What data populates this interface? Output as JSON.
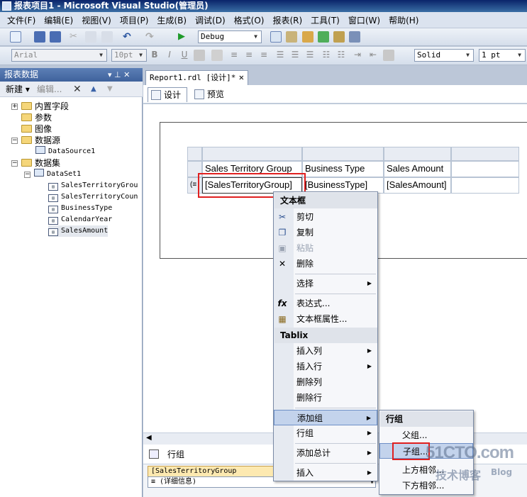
{
  "window": {
    "title": "报表项目1 - Microsoft Visual Studio(管理员)"
  },
  "menu": [
    "文件(F)",
    "编辑(E)",
    "视图(V)",
    "项目(P)",
    "生成(B)",
    "调试(D)",
    "格式(O)",
    "报表(R)",
    "工具(T)",
    "窗口(W)",
    "帮助(H)"
  ],
  "toolbar1": {
    "config": "Debug"
  },
  "toolbar2": {
    "font": "Arial",
    "size": "10pt",
    "border_style": "Solid",
    "border_width": "1 pt"
  },
  "report_data": {
    "title": "报表数据",
    "pin": "▾ ⊥ ✕",
    "new_label": "新建 ▾",
    "edit_label": "编辑...",
    "tree": [
      "内置字段",
      "参数",
      "图像",
      "数据源",
      "DataSource1",
      "数据集",
      "DataSet1",
      "SalesTerritoryGrou",
      "SalesTerritoryCoun",
      "BusinessType",
      "CalendarYear",
      "SalesAmount"
    ]
  },
  "document": {
    "tab": "Report1.rdl [设计]*",
    "design_tab": "设计",
    "preview_tab": "预览"
  },
  "tablix": {
    "headers": [
      "Sales Territory Group",
      "Business Type",
      "Sales Amount"
    ],
    "row": [
      "[SalesTerritoryGroup]",
      "[BusinessType]",
      "[SalesAmount]"
    ]
  },
  "context_menu": {
    "section_textbox": "文本框",
    "cut": "剪切",
    "copy": "复制",
    "paste": "粘贴",
    "delete": "删除",
    "select": "选择",
    "expression": "表达式...",
    "textbox_props": "文本框属性...",
    "section_tablix": "Tablix",
    "insert_col": "插入列",
    "insert_row": "插入行",
    "delete_col": "删除列",
    "delete_row": "删除行",
    "add_group": "添加组",
    "row_group": "行组",
    "add_total": "添加总计",
    "insert": "插入"
  },
  "submenu": {
    "section": "行组",
    "parent": "父组...",
    "child": "子组...",
    "above": "上方相邻...",
    "below": "下方相邻..."
  },
  "group_pane": {
    "title": "行组",
    "item1": "[SalesTerritoryGroup",
    "item2": "≡ (详细信息)"
  },
  "watermark": {
    "line1": "51CTO.com",
    "line2": "技术博客",
    "line3": "Blog"
  },
  "colors": {
    "highlight_red": "#e02020",
    "menu_highlight": "#c3d3ec",
    "title_blue": "#0a246a"
  }
}
